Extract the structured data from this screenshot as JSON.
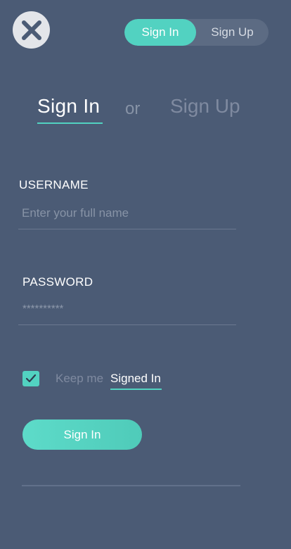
{
  "header": {
    "segmented": {
      "signin_label": "Sign In",
      "signup_label": "Sign Up",
      "active": "signin"
    }
  },
  "tabs": {
    "signin_label": "Sign In",
    "or_label": "or",
    "signup_label": "Sign Up"
  },
  "form": {
    "username_label": "USERNAME",
    "username_placeholder": "Enter your full name",
    "password_label": "PASSWORD",
    "password_value": "**********",
    "keep_label": "Keep me",
    "signed_in_label": "Signed In",
    "keep_checked": true,
    "submit_label": "Sign In"
  },
  "colors": {
    "background": "#4b5b75",
    "accent": "#52d2c1"
  },
  "icons": {
    "close": "close-icon",
    "check": "check-icon"
  }
}
